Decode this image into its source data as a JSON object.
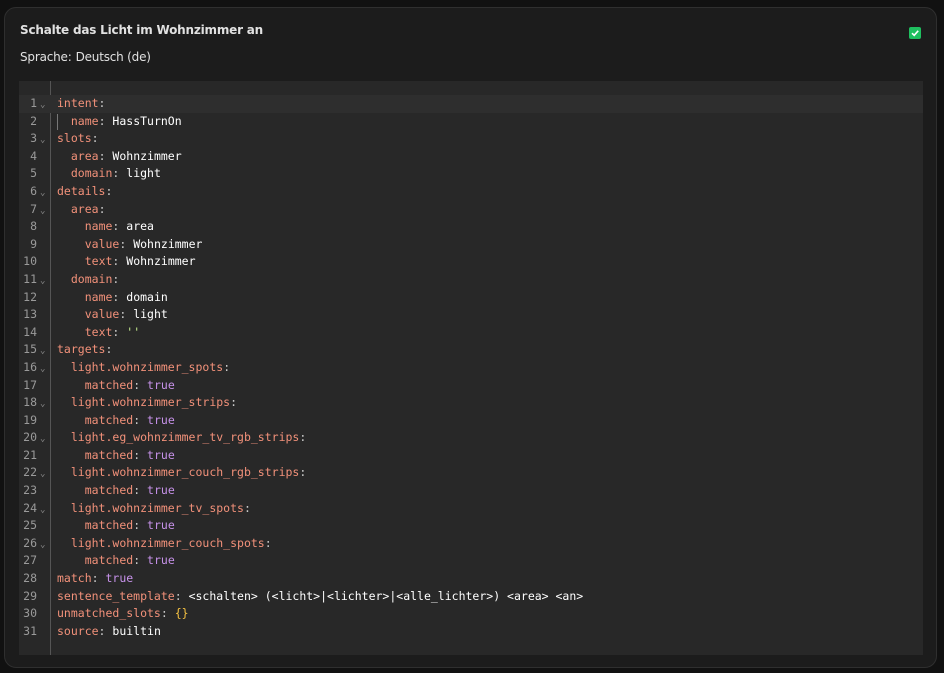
{
  "card": {
    "title": "Schalte das Licht im Wohnzimmer an",
    "language_label": "Sprache:",
    "language_value": "Deutsch (de)",
    "checked": true,
    "accent_color": "#1fbf5f"
  },
  "editor": {
    "lines": [
      {
        "n": "1",
        "fold": true,
        "active": true,
        "indent": 0,
        "parts": [
          {
            "t": "intent",
            "c": "k"
          },
          {
            "t": ":",
            "c": "p"
          }
        ]
      },
      {
        "n": "2",
        "fold": false,
        "indent": 2,
        "guide": true,
        "parts": [
          {
            "t": "name",
            "c": "k"
          },
          {
            "t": ": ",
            "c": "p"
          },
          {
            "t": "HassTurnOn",
            "c": "v"
          }
        ]
      },
      {
        "n": "3",
        "fold": true,
        "indent": 0,
        "parts": [
          {
            "t": "slots",
            "c": "k"
          },
          {
            "t": ":",
            "c": "p"
          }
        ]
      },
      {
        "n": "4",
        "fold": false,
        "indent": 2,
        "parts": [
          {
            "t": "area",
            "c": "k"
          },
          {
            "t": ": ",
            "c": "p"
          },
          {
            "t": "Wohnzimmer",
            "c": "v"
          }
        ]
      },
      {
        "n": "5",
        "fold": false,
        "indent": 2,
        "parts": [
          {
            "t": "domain",
            "c": "k"
          },
          {
            "t": ": ",
            "c": "p"
          },
          {
            "t": "light",
            "c": "v"
          }
        ]
      },
      {
        "n": "6",
        "fold": true,
        "indent": 0,
        "parts": [
          {
            "t": "details",
            "c": "k"
          },
          {
            "t": ":",
            "c": "p"
          }
        ]
      },
      {
        "n": "7",
        "fold": true,
        "indent": 2,
        "parts": [
          {
            "t": "area",
            "c": "k"
          },
          {
            "t": ":",
            "c": "p"
          }
        ]
      },
      {
        "n": "8",
        "fold": false,
        "indent": 4,
        "parts": [
          {
            "t": "name",
            "c": "k"
          },
          {
            "t": ": ",
            "c": "p"
          },
          {
            "t": "area",
            "c": "v"
          }
        ]
      },
      {
        "n": "9",
        "fold": false,
        "indent": 4,
        "parts": [
          {
            "t": "value",
            "c": "k"
          },
          {
            "t": ": ",
            "c": "p"
          },
          {
            "t": "Wohnzimmer",
            "c": "v"
          }
        ]
      },
      {
        "n": "10",
        "fold": false,
        "indent": 4,
        "parts": [
          {
            "t": "text",
            "c": "k"
          },
          {
            "t": ": ",
            "c": "p"
          },
          {
            "t": "Wohnzimmer",
            "c": "v"
          }
        ]
      },
      {
        "n": "11",
        "fold": true,
        "indent": 2,
        "parts": [
          {
            "t": "domain",
            "c": "k"
          },
          {
            "t": ":",
            "c": "p"
          }
        ]
      },
      {
        "n": "12",
        "fold": false,
        "indent": 4,
        "parts": [
          {
            "t": "name",
            "c": "k"
          },
          {
            "t": ": ",
            "c": "p"
          },
          {
            "t": "domain",
            "c": "v"
          }
        ]
      },
      {
        "n": "13",
        "fold": false,
        "indent": 4,
        "parts": [
          {
            "t": "value",
            "c": "k"
          },
          {
            "t": ": ",
            "c": "p"
          },
          {
            "t": "light",
            "c": "v"
          }
        ]
      },
      {
        "n": "14",
        "fold": false,
        "indent": 4,
        "parts": [
          {
            "t": "text",
            "c": "k"
          },
          {
            "t": ": ",
            "c": "p"
          },
          {
            "t": "''",
            "c": "s"
          }
        ]
      },
      {
        "n": "15",
        "fold": true,
        "indent": 0,
        "parts": [
          {
            "t": "targets",
            "c": "k"
          },
          {
            "t": ":",
            "c": "p"
          }
        ]
      },
      {
        "n": "16",
        "fold": true,
        "indent": 2,
        "parts": [
          {
            "t": "light.wohnzimmer_spots",
            "c": "k"
          },
          {
            "t": ":",
            "c": "p"
          }
        ]
      },
      {
        "n": "17",
        "fold": false,
        "indent": 4,
        "parts": [
          {
            "t": "matched",
            "c": "k"
          },
          {
            "t": ": ",
            "c": "p"
          },
          {
            "t": "true",
            "c": "b"
          }
        ]
      },
      {
        "n": "18",
        "fold": true,
        "indent": 2,
        "parts": [
          {
            "t": "light.wohnzimmer_strips",
            "c": "k"
          },
          {
            "t": ":",
            "c": "p"
          }
        ]
      },
      {
        "n": "19",
        "fold": false,
        "indent": 4,
        "parts": [
          {
            "t": "matched",
            "c": "k"
          },
          {
            "t": ": ",
            "c": "p"
          },
          {
            "t": "true",
            "c": "b"
          }
        ]
      },
      {
        "n": "20",
        "fold": true,
        "indent": 2,
        "parts": [
          {
            "t": "light.eg_wohnzimmer_tv_rgb_strips",
            "c": "k"
          },
          {
            "t": ":",
            "c": "p"
          }
        ]
      },
      {
        "n": "21",
        "fold": false,
        "indent": 4,
        "parts": [
          {
            "t": "matched",
            "c": "k"
          },
          {
            "t": ": ",
            "c": "p"
          },
          {
            "t": "true",
            "c": "b"
          }
        ]
      },
      {
        "n": "22",
        "fold": true,
        "indent": 2,
        "parts": [
          {
            "t": "light.wohnzimmer_couch_rgb_strips",
            "c": "k"
          },
          {
            "t": ":",
            "c": "p"
          }
        ]
      },
      {
        "n": "23",
        "fold": false,
        "indent": 4,
        "parts": [
          {
            "t": "matched",
            "c": "k"
          },
          {
            "t": ": ",
            "c": "p"
          },
          {
            "t": "true",
            "c": "b"
          }
        ]
      },
      {
        "n": "24",
        "fold": true,
        "indent": 2,
        "parts": [
          {
            "t": "light.wohnzimmer_tv_spots",
            "c": "k"
          },
          {
            "t": ":",
            "c": "p"
          }
        ]
      },
      {
        "n": "25",
        "fold": false,
        "indent": 4,
        "parts": [
          {
            "t": "matched",
            "c": "k"
          },
          {
            "t": ": ",
            "c": "p"
          },
          {
            "t": "true",
            "c": "b"
          }
        ]
      },
      {
        "n": "26",
        "fold": true,
        "indent": 2,
        "parts": [
          {
            "t": "light.wohnzimmer_couch_spots",
            "c": "k"
          },
          {
            "t": ":",
            "c": "p"
          }
        ]
      },
      {
        "n": "27",
        "fold": false,
        "indent": 4,
        "parts": [
          {
            "t": "matched",
            "c": "k"
          },
          {
            "t": ": ",
            "c": "p"
          },
          {
            "t": "true",
            "c": "b"
          }
        ]
      },
      {
        "n": "28",
        "fold": false,
        "indent": 0,
        "parts": [
          {
            "t": "match",
            "c": "k"
          },
          {
            "t": ": ",
            "c": "p"
          },
          {
            "t": "true",
            "c": "b"
          }
        ]
      },
      {
        "n": "29",
        "fold": false,
        "indent": 0,
        "parts": [
          {
            "t": "sentence_template",
            "c": "k"
          },
          {
            "t": ": ",
            "c": "p"
          },
          {
            "t": "<schalten> (<licht>|<lichter>|<alle_lichter>) <area> <an>",
            "c": "v"
          }
        ]
      },
      {
        "n": "30",
        "fold": false,
        "indent": 0,
        "parts": [
          {
            "t": "unmatched_slots",
            "c": "k"
          },
          {
            "t": ": ",
            "c": "p"
          },
          {
            "t": "{}",
            "c": "o"
          }
        ]
      },
      {
        "n": "31",
        "fold": false,
        "indent": 0,
        "parts": [
          {
            "t": "source",
            "c": "k"
          },
          {
            "t": ": ",
            "c": "p"
          },
          {
            "t": "builtin",
            "c": "v"
          }
        ]
      }
    ]
  }
}
